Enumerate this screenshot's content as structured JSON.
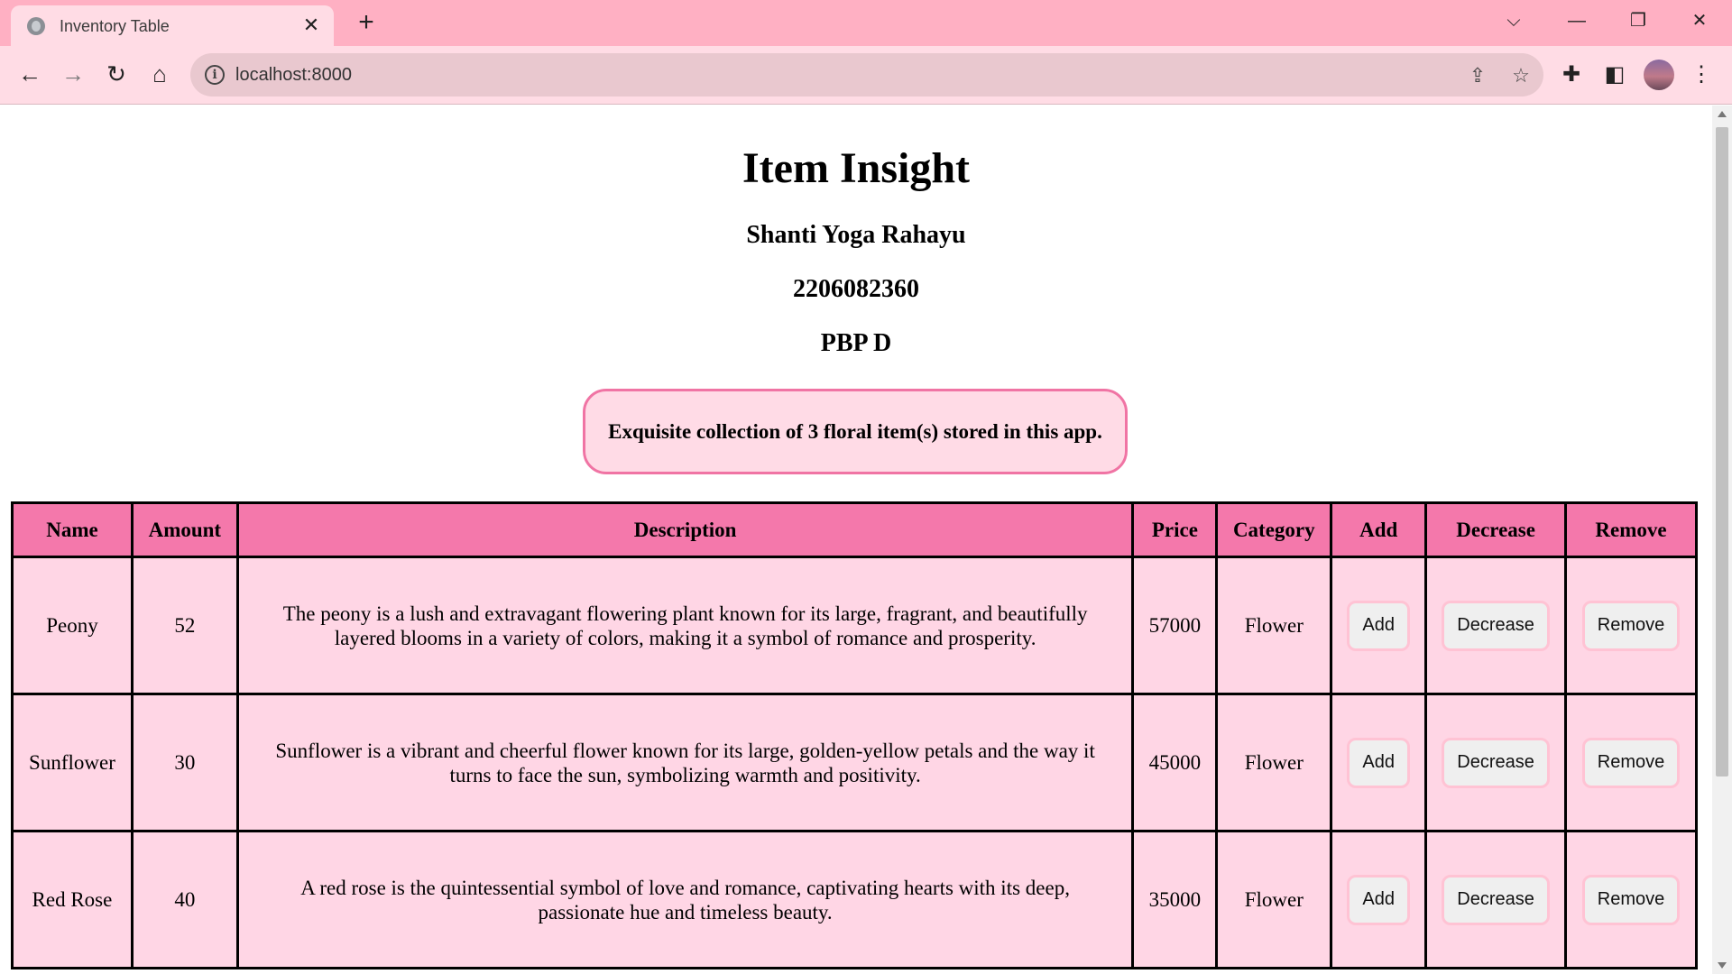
{
  "browser": {
    "tab_title": "Inventory Table",
    "url": "localhost:8000"
  },
  "page": {
    "title": "Item Insight",
    "author_name": "Shanti Yoga Rahayu",
    "student_id": "2206082360",
    "class_name": "PBP D",
    "banner_text": "Exquisite collection of 3 floral item(s) stored in this app."
  },
  "table": {
    "headers": [
      "Name",
      "Amount",
      "Description",
      "Price",
      "Category",
      "Add",
      "Decrease",
      "Remove"
    ],
    "rows": [
      {
        "name": "Peony",
        "amount": "52",
        "description": "The peony is a lush and extravagant flowering plant known for its large, fragrant, and beautifully layered blooms in a variety of colors, making it a symbol of romance and prosperity.",
        "price": "57000",
        "category": "Flower",
        "add_label": "Add",
        "decrease_label": "Decrease",
        "remove_label": "Remove"
      },
      {
        "name": "Sunflower",
        "amount": "30",
        "description": "Sunflower is a vibrant and cheerful flower known for its large, golden-yellow petals and the way it turns to face the sun, symbolizing warmth and positivity.",
        "price": "45000",
        "category": "Flower",
        "add_label": "Add",
        "decrease_label": "Decrease",
        "remove_label": "Remove"
      },
      {
        "name": "Red Rose",
        "amount": "40",
        "description": "A red rose is the quintessential symbol of love and romance, captivating hearts with its deep, passionate hue and timeless beauty.",
        "price": "35000",
        "category": "Flower",
        "add_label": "Add",
        "decrease_label": "Decrease",
        "remove_label": "Remove"
      }
    ]
  },
  "colors": {
    "tabstrip": "#ffb0c3",
    "toolbar": "#ffdce5",
    "header_row": "#f478ab",
    "body_row": "#ffd6e5",
    "banner_border": "#f074a4"
  },
  "icons": [
    "globe-icon",
    "close-icon",
    "plus-icon",
    "chevron-down-icon",
    "minimize-icon",
    "restore-icon",
    "back-icon",
    "forward-icon",
    "reload-icon",
    "home-icon",
    "info-icon",
    "share-icon",
    "star-icon",
    "puzzle-icon",
    "side-panel-icon",
    "kebab-menu-icon"
  ]
}
